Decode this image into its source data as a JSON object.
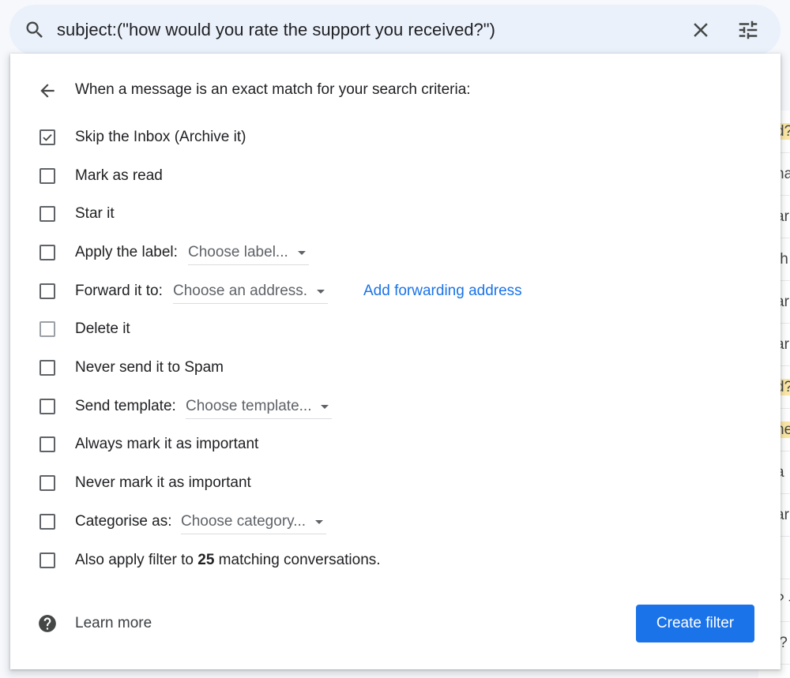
{
  "search": {
    "query": "subject:(\"how would you rate the support you received?\")"
  },
  "background_list": [
    {
      "text": "d?",
      "highlight": true
    },
    {
      "text": "na",
      "highlight": false
    },
    {
      "text": "ar",
      "highlight": false
    },
    {
      "text": "th",
      "highlight": false
    },
    {
      "text": "ar",
      "highlight": false
    },
    {
      "text": "ar",
      "highlight": false
    },
    {
      "text": "d?",
      "highlight": true
    },
    {
      "text": "ne",
      "highlight": true
    },
    {
      "text": "a",
      "highlight": false
    },
    {
      "text": "ar",
      "highlight": false
    },
    {
      "text": "-",
      "highlight": false
    },
    {
      "text": "? -",
      "highlight": false
    },
    {
      "text": "l?",
      "highlight": false
    }
  ],
  "panel": {
    "heading": "When a message is an exact match for your search criteria:",
    "options": {
      "skip_inbox": {
        "label": "Skip the Inbox (Archive it)",
        "checked": true
      },
      "mark_read": {
        "label": "Mark as read",
        "checked": false
      },
      "star": {
        "label": "Star it",
        "checked": false
      },
      "apply_label": {
        "label": "Apply the label:",
        "dropdown": "Choose label...",
        "checked": false
      },
      "forward": {
        "label": "Forward it to:",
        "dropdown": "Choose an address.",
        "link": "Add forwarding address",
        "checked": false
      },
      "delete": {
        "label": "Delete it",
        "checked": false
      },
      "never_spam": {
        "label": "Never send it to Spam",
        "checked": false
      },
      "send_template": {
        "label": "Send template:",
        "dropdown": "Choose template...",
        "checked": false
      },
      "always_important": {
        "label": "Always mark it as important",
        "checked": false
      },
      "never_important": {
        "label": "Never mark it as important",
        "checked": false
      },
      "categorise": {
        "label": "Categorise as:",
        "dropdown": "Choose category...",
        "checked": false
      },
      "apply_existing": {
        "label_prefix": "Also apply filter to ",
        "count": "25",
        "label_suffix": " matching conversations.",
        "checked": false
      }
    },
    "learn_more": "Learn more",
    "create_button": "Create filter"
  },
  "colors": {
    "accent": "#1a73e8",
    "search_bg": "#eaf1fb",
    "highlight": "#fce8a6"
  },
  "icons": [
    "search-icon",
    "close-icon",
    "tune-icon",
    "arrow-back-icon",
    "check-icon",
    "help-icon"
  ]
}
